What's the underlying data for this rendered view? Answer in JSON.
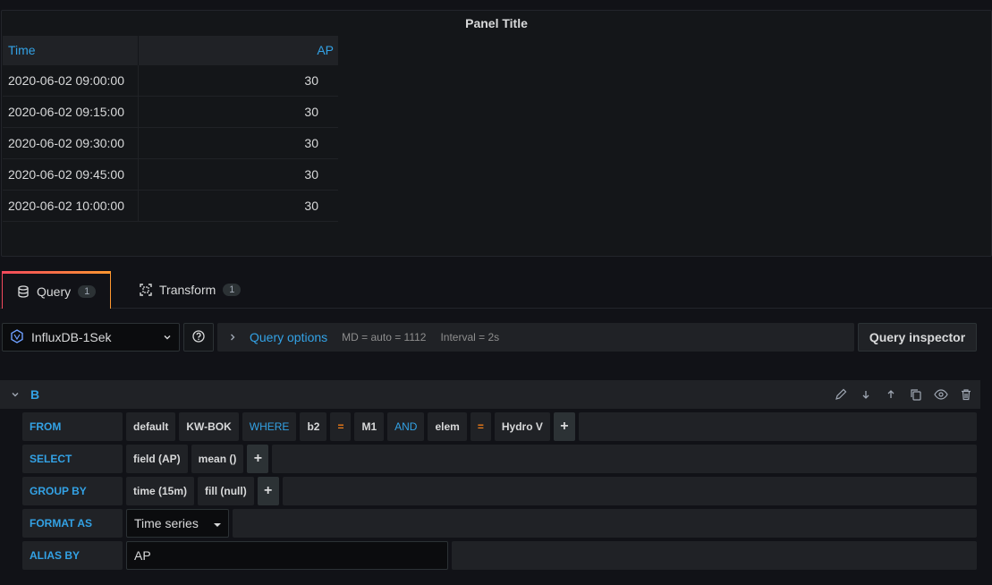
{
  "panel": {
    "title": "Panel Title",
    "table": {
      "columns": [
        "Time",
        "AP"
      ],
      "rows": [
        [
          "2020-06-02 09:00:00",
          "30"
        ],
        [
          "2020-06-02 09:15:00",
          "30"
        ],
        [
          "2020-06-02 09:30:00",
          "30"
        ],
        [
          "2020-06-02 09:45:00",
          "30"
        ],
        [
          "2020-06-02 10:00:00",
          "30"
        ]
      ]
    }
  },
  "tabs": [
    {
      "label": "Query",
      "count": "1"
    },
    {
      "label": "Transform",
      "count": "1"
    }
  ],
  "datasource": {
    "name": "InfluxDB-1Sek",
    "icon": "influxdb-icon"
  },
  "query_options": {
    "label": "Query options",
    "md": "MD = auto = 1112",
    "interval": "Interval = 2s"
  },
  "query_inspector_label": "Query inspector",
  "query_row": {
    "ref_id": "B",
    "from": {
      "label": "FROM",
      "policy": "default",
      "measurement": "KW-BOK",
      "where": "WHERE",
      "tag1": "b2",
      "op1": "=",
      "val1": "M1",
      "and": "AND",
      "tag2": "elem",
      "op2": "=",
      "val2": "Hydro V",
      "plus": "+"
    },
    "select": {
      "label": "SELECT",
      "field": "field (AP)",
      "agg": "mean ()",
      "plus": "+"
    },
    "group_by": {
      "label": "GROUP BY",
      "time": "time (15m)",
      "fill": "fill (null)",
      "plus": "+"
    },
    "format_as": {
      "label": "FORMAT AS",
      "value": "Time series"
    },
    "alias_by": {
      "label": "ALIAS BY",
      "value": "AP"
    }
  },
  "colors": {
    "accent": "#33a2e5",
    "operator": "#eb7b18",
    "bg": "#111217",
    "panel": "#202226"
  }
}
